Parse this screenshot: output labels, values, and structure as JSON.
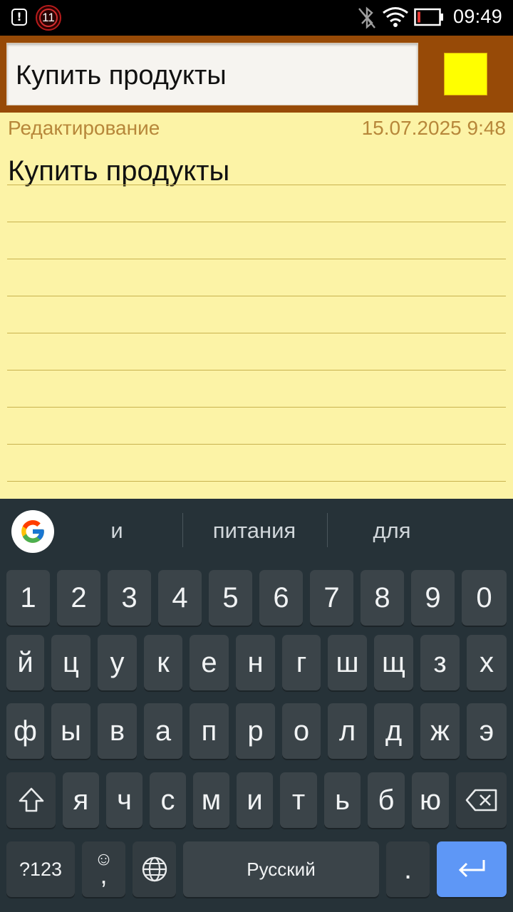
{
  "status_bar": {
    "notification_badge": "11",
    "alert_glyph": "!",
    "time": "09:49",
    "icons": [
      "alert-icon",
      "notification-count-badge",
      "bluetooth-off-icon",
      "wifi-icon",
      "battery-low-icon"
    ]
  },
  "header": {
    "title_value": "Купить продукты",
    "color_swatch": "#ffff00"
  },
  "note": {
    "mode_label": "Редактирование",
    "date": "15.07.2025 9:48",
    "body": "Купить продукты",
    "background": "#fcf3a6"
  },
  "keyboard": {
    "suggestions": [
      "и",
      "питания",
      "для"
    ],
    "number_row": [
      "1",
      "2",
      "3",
      "4",
      "5",
      "6",
      "7",
      "8",
      "9",
      "0"
    ],
    "row1": [
      "й",
      "ц",
      "у",
      "к",
      "е",
      "н",
      "г",
      "ш",
      "щ",
      "з",
      "х"
    ],
    "row2": [
      "ф",
      "ы",
      "в",
      "а",
      "п",
      "р",
      "о",
      "л",
      "д",
      "ж",
      "э"
    ],
    "row3": [
      "я",
      "ч",
      "с",
      "м",
      "и",
      "т",
      "ь",
      "б",
      "ю"
    ],
    "symbols_key": "?123",
    "emoji_key_top": "☺",
    "comma_key": ",",
    "space_label": "Русский",
    "period_key": ".",
    "accent_color": "#5e97f6"
  }
}
